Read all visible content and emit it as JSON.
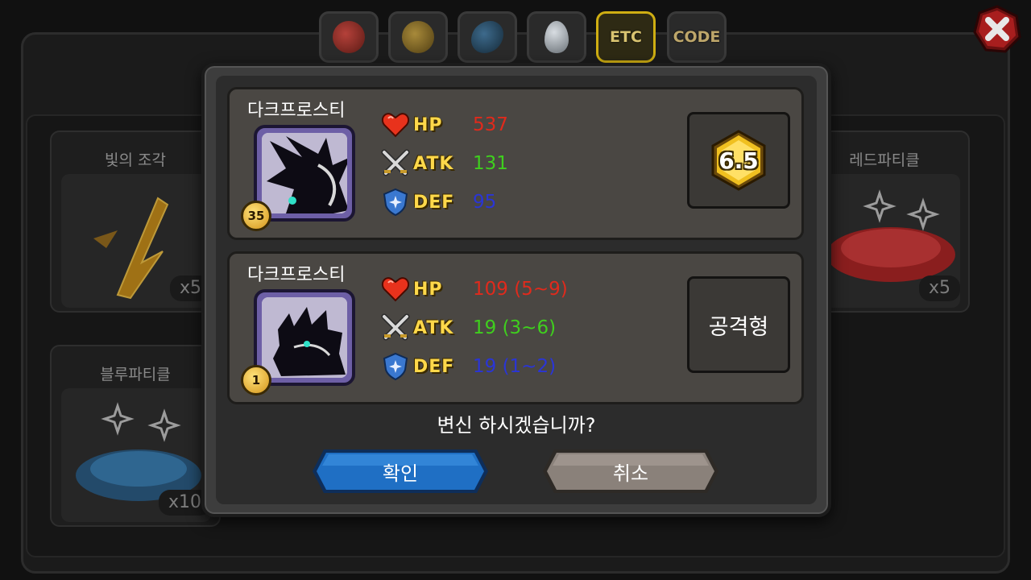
{
  "tabs": [
    {
      "kind": "fruit-icon"
    },
    {
      "kind": "cookie-icon"
    },
    {
      "kind": "feather-icon"
    },
    {
      "kind": "egg-icon"
    },
    {
      "label": "ETC",
      "active": true
    },
    {
      "label": "CODE",
      "active": false
    }
  ],
  "background_items": [
    {
      "title": "빛의 조각",
      "count": "x5"
    },
    {
      "title": "레드파티클",
      "count": "x5"
    },
    {
      "title": "블루파티클",
      "count": "x10"
    }
  ],
  "current_pet": {
    "name": "다크프로스티",
    "level": "35",
    "hp_label": "HP",
    "hp": "537",
    "atk_label": "ATK",
    "atk": "131",
    "def_label": "DEF",
    "def": "95",
    "grade": "6.5"
  },
  "new_pet": {
    "name": "다크프로스티",
    "level": "1",
    "hp_label": "HP",
    "hp": "109 (5~9)",
    "atk_label": "ATK",
    "atk": "19 (3~6)",
    "def_label": "DEF",
    "def": "19 (1~2)",
    "type": "공격형"
  },
  "question": "변신 하시겠습니까?",
  "confirm_label": "확인",
  "cancel_label": "취소",
  "colors": {
    "hp": "#e02a1c",
    "atk": "#3fcf1e",
    "def": "#2a35d6",
    "confirm": "#1f6fc4",
    "cancel": "#8a817a"
  }
}
